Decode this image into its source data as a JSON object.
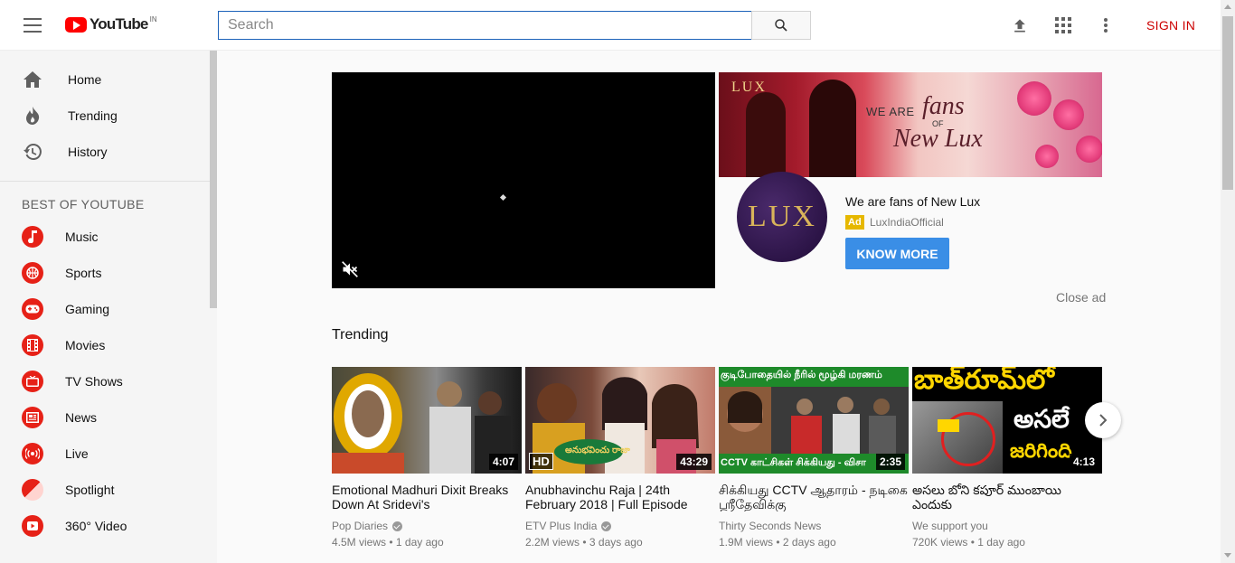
{
  "header": {
    "logo_text": "YouTube",
    "logo_country": "IN",
    "search_placeholder": "Search",
    "signin_label": "SIGN IN"
  },
  "sidebar": {
    "main_items": [
      {
        "label": "Home",
        "icon": "home-icon"
      },
      {
        "label": "Trending",
        "icon": "flame-icon"
      },
      {
        "label": "History",
        "icon": "history-icon"
      }
    ],
    "section_title": "BEST OF YOUTUBE",
    "categories": [
      {
        "label": "Music",
        "icon": "music-icon"
      },
      {
        "label": "Sports",
        "icon": "sports-icon"
      },
      {
        "label": "Gaming",
        "icon": "gaming-icon"
      },
      {
        "label": "Movies",
        "icon": "movies-icon"
      },
      {
        "label": "TV Shows",
        "icon": "tv-icon"
      },
      {
        "label": "News",
        "icon": "news-icon"
      },
      {
        "label": "Live",
        "icon": "live-icon"
      },
      {
        "label": "Spotlight",
        "icon": "spotlight-icon"
      },
      {
        "label": "360° Video",
        "icon": "360-video-icon"
      }
    ]
  },
  "ad": {
    "banner_logo": "LUX",
    "banner_line1": "WE ARE",
    "banner_line2": "fans",
    "banner_line3": "OF",
    "banner_line4": "New Lux",
    "logo_text": "LUX",
    "title": "We are fans of New Lux",
    "badge": "Ad",
    "channel": "LuxIndiaOfficial",
    "cta": "KNOW MORE",
    "close": "Close ad"
  },
  "trending": {
    "title": "Trending",
    "videos": [
      {
        "title": "Emotional Madhuri Dixit Breaks Down At Sridevi's",
        "channel": "Pop Diaries",
        "verified": true,
        "views": "4.5M views",
        "age": "1 day ago",
        "duration": "4:07",
        "hd": false
      },
      {
        "title": "Anubhavinchu Raja | 24th February 2018 | Full Episode",
        "channel": "ETV Plus India",
        "verified": true,
        "views": "2.2M views",
        "age": "3 days ago",
        "duration": "43:29",
        "hd": true
      },
      {
        "title": "சிக்கியது CCTV ஆதாரம் - நடிகை ஸ்ரீதேவிக்கு",
        "channel": "Thirty Seconds News",
        "verified": false,
        "views": "1.9M views",
        "age": "2 days ago",
        "duration": "2:35",
        "hd": false
      },
      {
        "title": "అసలు బోని కపూర్ ముంబాయి ఎందుకు",
        "channel": "We support you",
        "verified": false,
        "views": "720K views",
        "age": "1 day ago",
        "duration": "4:13",
        "hd": false
      }
    ],
    "thumb_overlays": {
      "v1_hd_badge": "HD",
      "v2_top": "குடிபோதையில் நீரில் மூழ்கி மரணம்",
      "v2_bottom": "CCTV காட்சிகள் சிக்கியது - விசா",
      "v3_top": "బాత్‌రూమ్‌లో",
      "v3_mid": "అసలే",
      "v3_bottom": "జరిగింది",
      "v1_logo": "అనుభవించు రాజా"
    }
  },
  "colors": {
    "brand_red": "#ff0000",
    "signin_red": "#cc0000",
    "cta_blue": "#3a8ee6",
    "ad_badge": "#e6b800"
  }
}
